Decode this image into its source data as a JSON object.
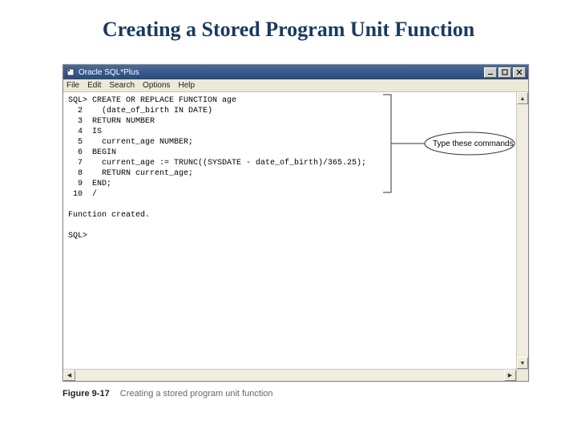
{
  "slide": {
    "title": "Creating a Stored Program Unit Function"
  },
  "window": {
    "title": "Oracle SQL*Plus",
    "menus": [
      "File",
      "Edit",
      "Search",
      "Options",
      "Help"
    ]
  },
  "terminal": {
    "lines": [
      "SQL> CREATE OR REPLACE FUNCTION age",
      "  2    (date_of_birth IN DATE)",
      "  3  RETURN NUMBER",
      "  4  IS",
      "  5    current_age NUMBER;",
      "  6  BEGIN",
      "  7    current_age := TRUNC((SYSDATE - date_of_birth)/365.25);",
      "  8    RETURN current_age;",
      "  9  END;",
      " 10  /",
      "",
      "Function created.",
      "",
      "SQL>"
    ]
  },
  "callout": {
    "label": "Type these commands"
  },
  "caption": {
    "figure": "Figure 9-17",
    "text": "Creating a stored program unit function"
  }
}
